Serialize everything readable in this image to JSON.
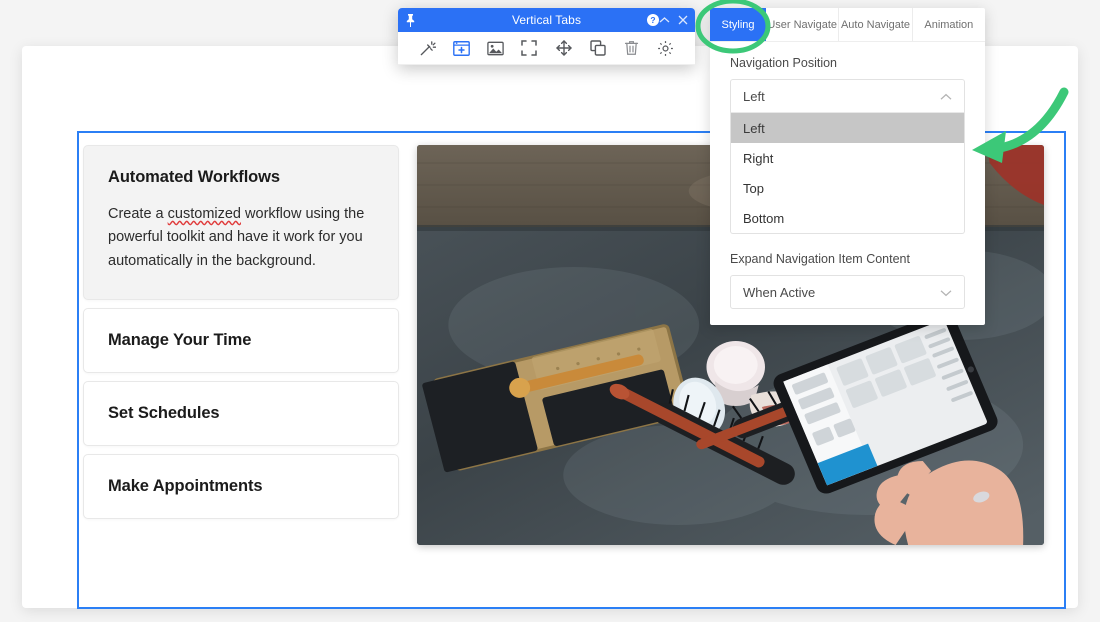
{
  "modal": {
    "title": "Vertical Tabs",
    "pin_icon": "pin-icon",
    "help_icon": "help-circle-icon",
    "collapse_icon": "chevron-up-icon",
    "close_icon": "close-icon",
    "toolbar": [
      {
        "name": "magic-wand-icon",
        "label": "Magic Wand",
        "active": false
      },
      {
        "name": "add-module-icon",
        "label": "Add Module",
        "active": true
      },
      {
        "name": "image-icon",
        "label": "Image",
        "active": false
      },
      {
        "name": "fullscreen-icon",
        "label": "Fullscreen",
        "active": false
      },
      {
        "name": "move-icon",
        "label": "Move",
        "active": false
      },
      {
        "name": "duplicate-icon",
        "label": "Duplicate",
        "active": false
      },
      {
        "name": "trash-icon",
        "label": "Delete",
        "active": false
      },
      {
        "name": "gear-icon",
        "label": "Settings",
        "active": false
      }
    ]
  },
  "options": {
    "tabs": [
      {
        "label": "Styling",
        "active": true
      },
      {
        "label": "User Navigate",
        "active": false
      },
      {
        "label": "Auto Navigate",
        "active": false
      },
      {
        "label": "Animation",
        "active": false
      }
    ],
    "navigation_position": {
      "label": "Navigation Position",
      "value": "Left",
      "expanded": true,
      "chevron_icon": "chevron-up-icon",
      "options": [
        "Left",
        "Right",
        "Top",
        "Bottom"
      ],
      "highlighted": "Left"
    },
    "expand_nav_item": {
      "label": "Expand Navigation Item Content",
      "value": "When Active",
      "expanded": false,
      "chevron_icon": "chevron-down-icon"
    }
  },
  "module": {
    "tabs": [
      {
        "title": "Automated Workflows",
        "active": true,
        "body_before": "Create a ",
        "body_misspelled": "customized",
        "body_after": " workflow using the powerful toolkit and have it work for you automatically in the background."
      },
      {
        "title": "Manage Your Time",
        "active": false
      },
      {
        "title": "Set Schedules",
        "active": false
      },
      {
        "title": "Make Appointments",
        "active": false
      }
    ],
    "photo_alt": "Overhead desk photo with brushes, cups, gift box, tablet and a hand"
  },
  "colors": {
    "accent_blue": "#2b71f5",
    "module_border": "#2b7ff5",
    "annotation_green": "#3cc878",
    "active_tab_bg": "#f3f3f3",
    "option_highlight": "#c6c6c6",
    "spellcheck_red": "#e03c3c"
  }
}
